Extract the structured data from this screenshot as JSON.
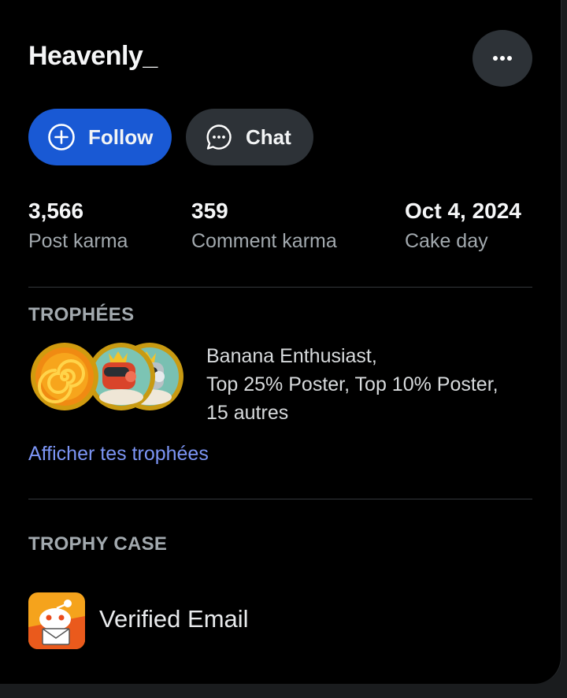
{
  "profile": {
    "username": "Heavenly_"
  },
  "actions": {
    "follow_label": "Follow",
    "chat_label": "Chat",
    "more_icon": "more-horizontal-icon"
  },
  "stats": [
    {
      "value": "3,566",
      "label": "Post karma"
    },
    {
      "value": "359",
      "label": "Comment karma"
    },
    {
      "value": "Oct 4, 2024",
      "label": "Cake day"
    }
  ],
  "trophies_section": {
    "heading": "TROPHÉES",
    "line1": "Banana Enthusiast,",
    "line2": "Top 25% Poster, Top 10% Poster,",
    "line3": "15 autres",
    "link": "Afficher tes trophées"
  },
  "trophy_case": {
    "heading": "TROPHY CASE",
    "items": [
      {
        "label": "Verified Email",
        "icon": "verified-email-icon"
      }
    ]
  },
  "colors": {
    "follow_button": "#1959d4",
    "secondary_button": "#2d3237",
    "link": "#7c95f5",
    "background": "#000000"
  }
}
